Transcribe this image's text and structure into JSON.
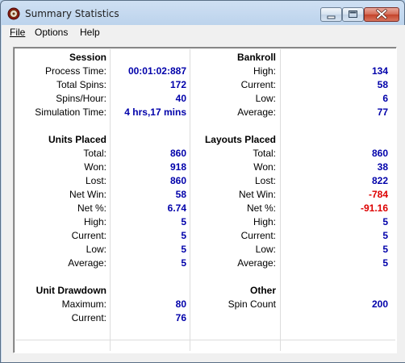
{
  "window": {
    "title": "Summary Statistics",
    "icon": "roulette-wheel-icon",
    "controls": [
      "minimize-icon",
      "maximize-icon",
      "close-icon"
    ]
  },
  "menu": {
    "file": "File",
    "options": "Options",
    "help": "Help"
  },
  "session": {
    "header": "Session",
    "rows": [
      {
        "label": "Process Time:",
        "value": "00:01:02:887"
      },
      {
        "label": "Total Spins:",
        "value": "172"
      },
      {
        "label": "Spins/Hour:",
        "value": "40"
      },
      {
        "label": "Simulation Time:",
        "value": "4 hrs,17 mins"
      }
    ]
  },
  "bankroll": {
    "header": "Bankroll",
    "rows": [
      {
        "label": "High:",
        "value": "134"
      },
      {
        "label": "Current:",
        "value": "58"
      },
      {
        "label": "Low:",
        "value": "6"
      },
      {
        "label": "Average:",
        "value": "77"
      }
    ]
  },
  "units_placed": {
    "header": "Units Placed",
    "rows": [
      {
        "label": "Total:",
        "value": "860"
      },
      {
        "label": "Won:",
        "value": "918"
      },
      {
        "label": "Lost:",
        "value": "860"
      },
      {
        "label": "Net Win:",
        "value": "58"
      },
      {
        "label": "Net %:",
        "value": "6.74"
      },
      {
        "label": "High:",
        "value": "5"
      },
      {
        "label": "Current:",
        "value": "5"
      },
      {
        "label": "Low:",
        "value": "5"
      },
      {
        "label": "Average:",
        "value": "5"
      }
    ]
  },
  "layouts_placed": {
    "header": "Layouts Placed",
    "rows": [
      {
        "label": "Total:",
        "value": "860"
      },
      {
        "label": "Won:",
        "value": "38"
      },
      {
        "label": "Lost:",
        "value": "822"
      },
      {
        "label": "Net Win:",
        "value": "-784"
      },
      {
        "label": "Net %:",
        "value": "-91.16"
      },
      {
        "label": "High:",
        "value": "5"
      },
      {
        "label": "Current:",
        "value": "5"
      },
      {
        "label": "Low:",
        "value": "5"
      },
      {
        "label": "Average:",
        "value": "5"
      }
    ]
  },
  "unit_drawdown": {
    "header": "Unit Drawdown",
    "rows": [
      {
        "label": "Maximum:",
        "value": "80"
      },
      {
        "label": "Current:",
        "value": "76"
      }
    ]
  },
  "other": {
    "header": "Other",
    "rows": [
      {
        "label": "Spin Count",
        "value": "200"
      }
    ]
  },
  "colors": {
    "value_text": "#0000aa",
    "negative_text": "#dd0000"
  }
}
